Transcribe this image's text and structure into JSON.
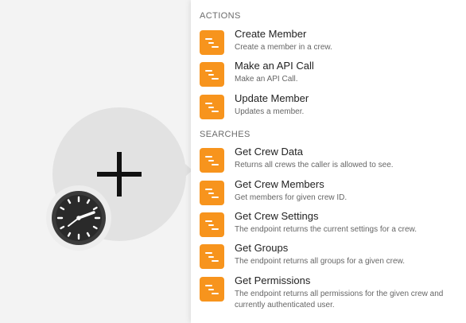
{
  "module": {
    "add_icon": "plus-icon",
    "trigger_icon": "clock-icon"
  },
  "panel": {
    "sections": [
      {
        "header": "ACTIONS",
        "items": [
          {
            "title": "Create Member",
            "description": "Create a member in a crew."
          },
          {
            "title": "Make an API Call",
            "description": "Make an API Call."
          },
          {
            "title": "Update Member",
            "description": "Updates a member."
          }
        ]
      },
      {
        "header": "SEARCHES",
        "items": [
          {
            "title": "Get Crew Data",
            "description": "Returns all crews the caller is allowed to see."
          },
          {
            "title": "Get Crew Members",
            "description": "Get members for given crew ID."
          },
          {
            "title": "Get Crew Settings",
            "description": "The endpoint returns the current settings for a crew."
          },
          {
            "title": "Get Groups",
            "description": "The endpoint returns all groups for a given crew."
          },
          {
            "title": "Get Permissions",
            "description": "The endpoint returns all permissions for the given crew and currently authenticated user."
          }
        ]
      }
    ],
    "item_icon": "app-logo-icon",
    "accent_color": "#f7941d"
  }
}
